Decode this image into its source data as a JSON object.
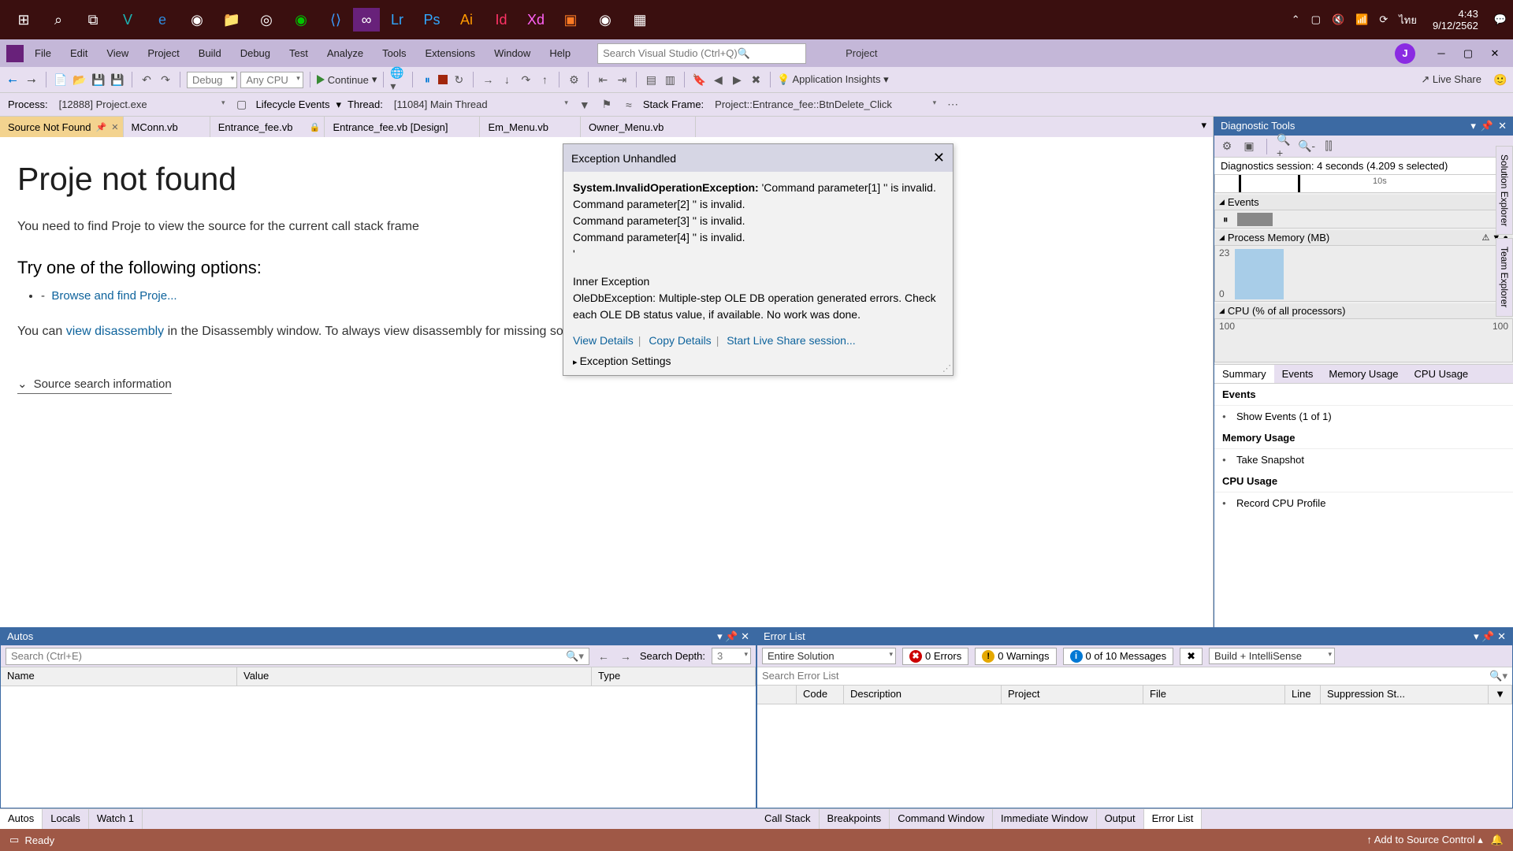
{
  "taskbar": {
    "clock_time": "4:43",
    "clock_date": "9/12/2562",
    "lang": "ไทย"
  },
  "vs": {
    "menu": [
      "File",
      "Edit",
      "View",
      "Project",
      "Build",
      "Debug",
      "Test",
      "Analyze",
      "Tools",
      "Extensions",
      "Window",
      "Help"
    ],
    "search_placeholder": "Search Visual Studio (Ctrl+Q)",
    "project_tab": "Project",
    "user_initial": "J",
    "debug_combo": "Debug",
    "cpu_combo": "Any CPU",
    "continue": "Continue",
    "app_insights": "Application Insights",
    "live_share": "Live Share"
  },
  "toolbar2": {
    "process_label": "Process:",
    "process_value": "[12888] Project.exe",
    "lifecycle": "Lifecycle Events",
    "thread_label": "Thread:",
    "thread_value": "[11084] Main Thread",
    "stack_label": "Stack Frame:",
    "stack_value": "Project::Entrance_fee::BtnDelete_Click"
  },
  "doc_tabs": [
    "Source Not Found",
    "MConn.vb",
    "Entrance_fee.vb",
    "Entrance_fee.vb [Design]",
    "Em_Menu.vb",
    "Owner_Menu.vb"
  ],
  "editor": {
    "title": "Proje not found",
    "p1": "You need to find Proje to view the source for the current call stack frame",
    "h2": "Try one of the following options:",
    "link1": "Browse and find Proje...",
    "p2a": "You can ",
    "p2link": "view disassembly",
    "p2b": " in the Disassembly window. To always view disassembly for missing source file",
    "expander": "Source search information"
  },
  "exception": {
    "title": "Exception Unhandled",
    "type": "System.InvalidOperationException:",
    "msg1": "'Command parameter[1] '' is invalid.",
    "msg2": "Command parameter[2] '' is invalid.",
    "msg3": "Command parameter[3] '' is invalid.",
    "msg4": "Command parameter[4] '' is invalid.",
    "inner_h": "Inner Exception",
    "inner": "OleDbException: Multiple-step OLE DB operation generated errors. Check each OLE DB status value, if available. No work was done.",
    "link_details": "View Details",
    "link_copy": "Copy Details",
    "link_liveshare": "Start Live Share session...",
    "settings": "Exception Settings"
  },
  "diag": {
    "title": "Diagnostic Tools",
    "session": "Diagnostics session: 4 seconds (4.209 s selected)",
    "timeline_lbl": "10s",
    "events_h": "Events",
    "mem_h": "Process Memory (MB)",
    "mem_top": "23",
    "mem_bot": "0",
    "cpu_h": "CPU (% of all processors)",
    "cpu_top": "100",
    "cpu_bot": "",
    "tabs": [
      "Summary",
      "Events",
      "Memory Usage",
      "CPU Usage"
    ],
    "ev_section": "Events",
    "ev_item": "Show Events (1 of 1)",
    "mu_section": "Memory Usage",
    "mu_item": "Take Snapshot",
    "cu_section": "CPU Usage",
    "cu_item": "Record CPU Profile"
  },
  "side_tabs": [
    "Solution Explorer",
    "Team Explorer"
  ],
  "autos": {
    "title": "Autos",
    "search_placeholder": "Search (Ctrl+E)",
    "depth_label": "Search Depth:",
    "depth_value": "3",
    "cols": [
      "Name",
      "Value",
      "Type"
    ]
  },
  "errorlist": {
    "title": "Error List",
    "scope": "Entire Solution",
    "errors": "0 Errors",
    "warnings": "0 Warnings",
    "messages": "0 of 10 Messages",
    "filter_combo": "Build + IntelliSense",
    "search_placeholder": "Search Error List",
    "cols": [
      "",
      "Code",
      "Description",
      "Project",
      "File",
      "Line",
      "Suppression St..."
    ]
  },
  "bottom_tabs_left": [
    "Autos",
    "Locals",
    "Watch 1"
  ],
  "bottom_tabs_right": [
    "Call Stack",
    "Breakpoints",
    "Command Window",
    "Immediate Window",
    "Output",
    "Error List"
  ],
  "status": {
    "ready": "Ready",
    "add_source": "Add to Source Control"
  }
}
